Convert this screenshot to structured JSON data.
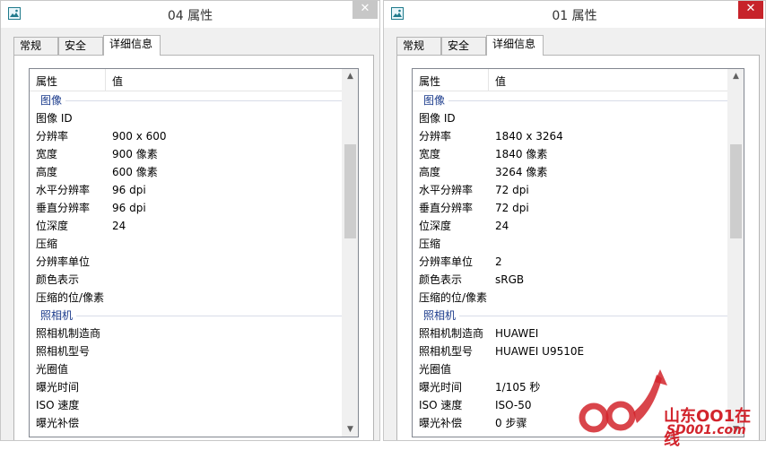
{
  "windows": [
    {
      "title": "04 属性",
      "close": "✕",
      "tabs": [
        "常规",
        "安全",
        "详细信息"
      ],
      "header": {
        "col1": "属性",
        "col2": "值"
      },
      "image_group": "图像",
      "image_rows": [
        {
          "k": "图像 ID",
          "v": ""
        },
        {
          "k": "分辨率",
          "v": "900 x 600"
        },
        {
          "k": "宽度",
          "v": "900 像素"
        },
        {
          "k": "高度",
          "v": "600 像素"
        },
        {
          "k": "水平分辨率",
          "v": "96 dpi"
        },
        {
          "k": "垂直分辨率",
          "v": "96 dpi"
        },
        {
          "k": "位深度",
          "v": "24"
        },
        {
          "k": "压缩",
          "v": ""
        },
        {
          "k": "分辨率单位",
          "v": ""
        },
        {
          "k": "颜色表示",
          "v": ""
        },
        {
          "k": "压缩的位/像素",
          "v": ""
        }
      ],
      "camera_group": "照相机",
      "camera_rows": [
        {
          "k": "照相机制造商",
          "v": ""
        },
        {
          "k": "照相机型号",
          "v": ""
        },
        {
          "k": "光圈值",
          "v": ""
        },
        {
          "k": "曝光时间",
          "v": ""
        },
        {
          "k": "ISO 速度",
          "v": ""
        },
        {
          "k": "曝光补偿",
          "v": ""
        }
      ]
    },
    {
      "title": "01 属性",
      "close": "✕",
      "tabs": [
        "常规",
        "安全",
        "详细信息"
      ],
      "header": {
        "col1": "属性",
        "col2": "值"
      },
      "image_group": "图像",
      "image_rows": [
        {
          "k": "图像 ID",
          "v": ""
        },
        {
          "k": "分辨率",
          "v": "1840 x 3264"
        },
        {
          "k": "宽度",
          "v": "1840 像素"
        },
        {
          "k": "高度",
          "v": "3264 像素"
        },
        {
          "k": "水平分辨率",
          "v": "72 dpi"
        },
        {
          "k": "垂直分辨率",
          "v": "72 dpi"
        },
        {
          "k": "位深度",
          "v": "24"
        },
        {
          "k": "压缩",
          "v": ""
        },
        {
          "k": "分辨率单位",
          "v": "2"
        },
        {
          "k": "颜色表示",
          "v": "sRGB"
        },
        {
          "k": "压缩的位/像素",
          "v": ""
        }
      ],
      "camera_group": "照相机",
      "camera_rows": [
        {
          "k": "照相机制造商",
          "v": "HUAWEI"
        },
        {
          "k": "照相机型号",
          "v": "HUAWEI U9510E"
        },
        {
          "k": "光圈值",
          "v": ""
        },
        {
          "k": "曝光时间",
          "v": "1/105 秒"
        },
        {
          "k": "ISO 速度",
          "v": "ISO-50"
        },
        {
          "k": "曝光补偿",
          "v": "0 步骤"
        }
      ]
    }
  ],
  "watermark": {
    "line1": "山东OO1在线",
    "line2": "SD001.com",
    "color": "#d2242c"
  }
}
